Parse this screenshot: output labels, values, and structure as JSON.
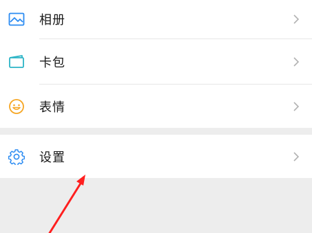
{
  "menu": {
    "items": [
      {
        "label": "相册",
        "icon": "album-icon"
      },
      {
        "label": "卡包",
        "icon": "card-wallet-icon"
      },
      {
        "label": "表情",
        "icon": "sticker-smile-icon"
      }
    ],
    "settings": {
      "label": "设置",
      "icon": "gear-icon"
    }
  },
  "colors": {
    "accent_blue": "#2a8bf2",
    "card_teal": "#2bb4c6",
    "sticker_orange": "#f6a623",
    "annotation_red": "#ff1f1f",
    "background": "#ededed"
  }
}
